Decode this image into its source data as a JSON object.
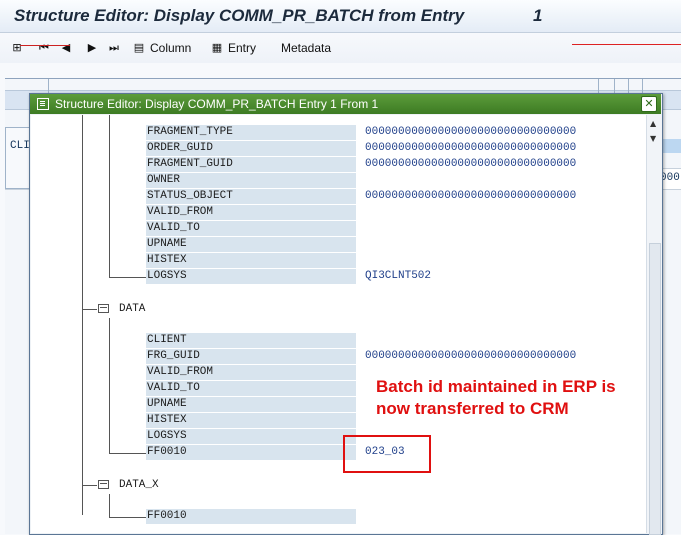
{
  "window": {
    "title": "Structure Editor: Display COMM_PR_BATCH from Entry",
    "entry_number": "1"
  },
  "toolbar": {
    "column_label": "Column",
    "entry_label": "Entry",
    "metadata_label": "Metadata"
  },
  "background": {
    "client_abbrev": "CLI",
    "right_value": "000"
  },
  "dialog": {
    "title": "Structure Editor: Display COMM_PR_BATCH Entry 1 From 1",
    "close_glyph": "✕"
  },
  "structure": {
    "header_fields": [
      {
        "name": "FRAGMENT_TYPE",
        "value": "00000000000000000000000000000000"
      },
      {
        "name": "ORDER_GUID",
        "value": "00000000000000000000000000000000"
      },
      {
        "name": "FRAGMENT_GUID",
        "value": "00000000000000000000000000000000"
      },
      {
        "name": "OWNER",
        "value": ""
      },
      {
        "name": "STATUS_OBJECT",
        "value": "00000000000000000000000000000000"
      },
      {
        "name": "VALID_FROM",
        "value": ""
      },
      {
        "name": "VALID_TO",
        "value": ""
      },
      {
        "name": "UPNAME",
        "value": ""
      },
      {
        "name": "HISTEX",
        "value": ""
      },
      {
        "name": "LOGSYS",
        "value": "QI3CLNT502"
      }
    ],
    "data_node": {
      "label": "DATA",
      "fields": [
        {
          "name": "CLIENT",
          "value": ""
        },
        {
          "name": "FRG_GUID",
          "value": "00000000000000000000000000000000"
        },
        {
          "name": "VALID_FROM",
          "value": ""
        },
        {
          "name": "VALID_TO",
          "value": ""
        },
        {
          "name": "UPNAME",
          "value": ""
        },
        {
          "name": "HISTEX",
          "value": ""
        },
        {
          "name": "LOGSYS",
          "value": ""
        },
        {
          "name": "FF0010",
          "value": "023_03"
        }
      ]
    },
    "data_x_node": {
      "label": "DATA_X",
      "fields": [
        {
          "name": "FF0010",
          "value": ""
        }
      ]
    }
  },
  "annotation": {
    "line1": "Batch id maintained in ERP is",
    "line2": "now transferred to CRM",
    "color": "#e01010"
  },
  "colors": {
    "dialog_titlebar": "#4a8a2e",
    "field_name_bg": "#d8e4ee",
    "value_text": "#1f3f8a"
  }
}
